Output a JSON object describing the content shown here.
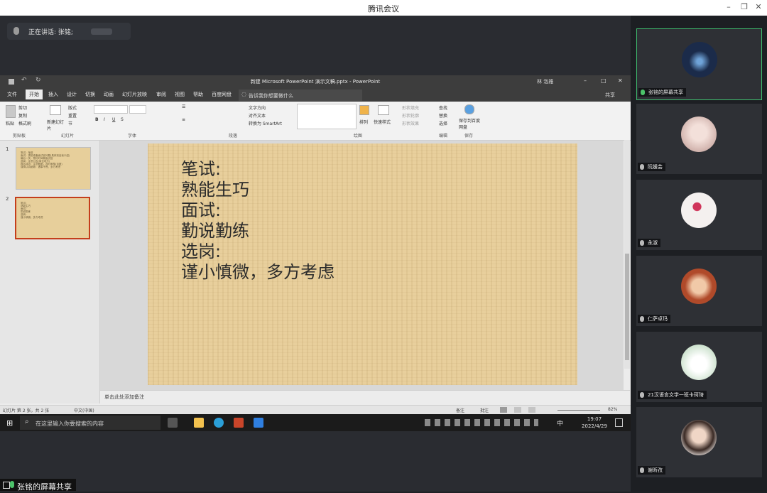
{
  "window": {
    "title": "腾讯会议"
  },
  "speaker": {
    "label": "正在讲话: 张铭;"
  },
  "ppt": {
    "title": "新建 Microsoft PowerPoint 演示文稿.pptx - PowerPoint",
    "user": "林 洛雅",
    "share": "共享",
    "tabs": [
      "文件",
      "开始",
      "插入",
      "设计",
      "切换",
      "动画",
      "幻灯片放映",
      "审阅",
      "视图",
      "帮助",
      "百度网盘"
    ],
    "tell_me": "告诉我你想要做什么",
    "ribbon_groups": [
      "剪贴板",
      "幻灯片",
      "字体",
      "段落",
      "绘图",
      "编辑",
      "保存"
    ],
    "ribbon_buttons": {
      "paste": "粘贴",
      "cut": "剪切",
      "copy": "复制",
      "format_painter": "格式刷",
      "new_slide": "新建幻灯片",
      "layout": "版式",
      "reset": "重置",
      "section": "节",
      "text_direction": "文字方向",
      "align_text": "对齐文本",
      "smartart": "转换为 SmartArt",
      "arrange": "排列",
      "quick_styles": "快速样式",
      "shape_fill": "形状填充",
      "shape_outline": "形状轮廓",
      "shape_effects": "形状效果",
      "find": "查找",
      "replace": "替换",
      "select": "选择",
      "save_baidu": "保存到百度网盘"
    },
    "thumbnails": [
      {
        "num": "1",
        "lines": [
          "笔试：渐进",
          "面试：提前准备面试官问题(具体到自我介绍)",
          "最后一关：预约时间聊面试官",
          "选岗：注意公告(岗位地方)",
          "报名成功：注意截图，及时审核(百度)",
          "谨慎认真细致：遇事不慌，多方考虑"
        ]
      },
      {
        "num": "2",
        "lines": [
          "笔试：",
          "熟能生巧",
          "面试：",
          "勤说勤练",
          "选岗：",
          "谨小慎微，多方考虑"
        ]
      }
    ],
    "slide_lines": [
      "笔试:",
      "熟能生巧",
      "面试:",
      "勤说勤练",
      "选岗:",
      "谨小慎微，多方考虑"
    ],
    "notes_placeholder": "单击此处添加备注",
    "status": {
      "slide_info": "幻灯片 第 2 张，共 2 张",
      "language": "中文(中国)",
      "notes": "备注",
      "comments": "批注",
      "zoom": "82%"
    }
  },
  "taskbar": {
    "search_placeholder": "在这里输入你要搜索的内容",
    "ime": "中",
    "time": "19:07",
    "date": "2022/4/29"
  },
  "participants": [
    {
      "name": "张铭的屏幕共享",
      "active": true,
      "mic": "green",
      "avatar_color": "#1b2b4a"
    },
    {
      "name": "阮媛芸",
      "active": false,
      "mic": "gray",
      "avatar_color": "#e7d6d2"
    },
    {
      "name": "永淑",
      "active": false,
      "mic": "gray",
      "avatar_color": "#f2eded"
    },
    {
      "name": "仁萨卓玛",
      "active": false,
      "mic": "gray",
      "avatar_color": "#b04a2a"
    },
    {
      "name": "21汉语言文学一班卡珂琦",
      "active": false,
      "mic": "gray",
      "avatar_color": "#e9eef0"
    },
    {
      "name": "谢昕孜",
      "active": false,
      "mic": "gray",
      "avatar_color": "#d6c0b0"
    }
  ],
  "share_label": "张铭的屏幕共享",
  "colors": {
    "accent_green": "#3fbf6f",
    "ppt_red": "#c43e1c",
    "slide_bg": "#e8cf9c"
  }
}
